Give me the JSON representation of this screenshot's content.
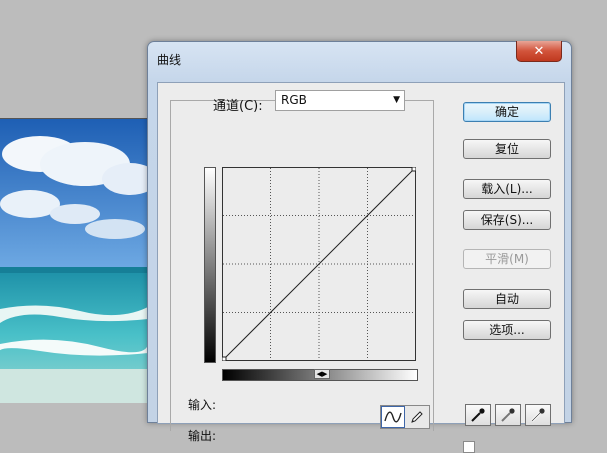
{
  "dialog": {
    "title": "曲线",
    "close_label": "✕"
  },
  "channel": {
    "label": "通道(C):",
    "value": "RGB",
    "dropdown_arrow": "▼"
  },
  "labels": {
    "input": "输入:",
    "output": "输出:"
  },
  "buttons": {
    "ok": "确定",
    "reset": "复位",
    "load": "载入(L)...",
    "save": "保存(S)...",
    "smooth": "平滑(M)",
    "auto": "自动",
    "options": "选项..."
  },
  "slider_handle": "◀▶",
  "icons": {
    "curve_tool": "curve-tool-icon",
    "pencil_tool": "pencil-icon",
    "black_eyedropper": "eyedropper-black-icon",
    "gray_eyedropper": "eyedropper-gray-icon",
    "white_eyedropper": "eyedropper-white-icon"
  },
  "colors": {
    "dialog_frame": "#c5d6ea",
    "close_button": "#d2543b",
    "primary_button": "#bee6fd"
  }
}
